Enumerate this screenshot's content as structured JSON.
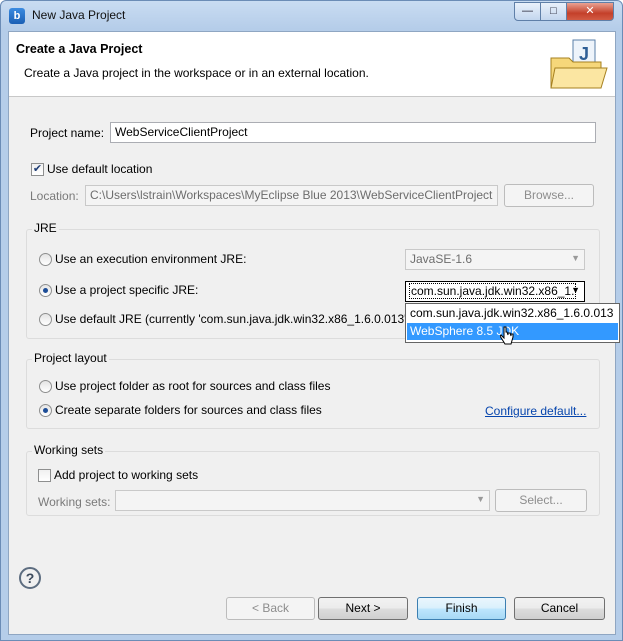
{
  "window": {
    "title": "New Java Project",
    "app_icon_letter": "b",
    "controls": {
      "minimize": "—",
      "maximize": "□",
      "close": "✕"
    }
  },
  "banner": {
    "title": "Create a Java Project",
    "description": "Create a Java project in the workspace or in an external location.",
    "icon": "folder-java-icon"
  },
  "project": {
    "name_label": "Project name:",
    "name_value": "WebServiceClientProject",
    "use_default_location_label": "Use default location",
    "use_default_location_checked": true,
    "location_label": "Location:",
    "location_value": "C:\\Users\\lstrain\\Workspaces\\MyEclipse Blue 2013\\WebServiceClientProject",
    "browse_label": "Browse..."
  },
  "jre": {
    "group_label": "JRE",
    "exec_env_label": "Use an execution environment JRE:",
    "exec_env_value": "JavaSE-1.6",
    "specific_label": "Use a project specific JRE:",
    "specific_value": "com.sun.java.jdk.win32.x86_1.",
    "default_label": "Use default JRE (currently 'com.sun.java.jdk.win32.x86_1.6.0.013')",
    "selected": "specific",
    "dropdown_options": [
      "com.sun.java.jdk.win32.x86_1.6.0.013",
      "WebSphere 8.5 JDK"
    ],
    "dropdown_highlighted": "WebSphere 8.5 JDK"
  },
  "layout": {
    "group_label": "Project layout",
    "root_label": "Use project folder as root for sources and class files",
    "separate_label": "Create separate folders for sources and class files",
    "selected": "separate",
    "configure_link": "Configure default..."
  },
  "working_sets": {
    "group_label": "Working sets",
    "add_label": "Add project to working sets",
    "add_checked": false,
    "sets_label": "Working sets:",
    "select_label": "Select..."
  },
  "footer": {
    "help_icon": "help-icon",
    "back_label": "< Back",
    "next_label": "Next >",
    "finish_label": "Finish",
    "cancel_label": "Cancel"
  },
  "colors": {
    "title_gradient": "#b5cde9",
    "dialog_bg": "#f0f0f0",
    "highlight": "#3399ff",
    "link": "#0645ad"
  }
}
